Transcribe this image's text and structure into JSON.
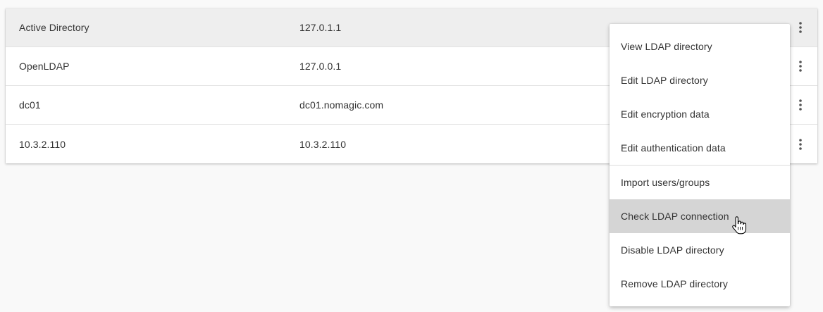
{
  "directories": [
    {
      "name": "Active Directory",
      "host": "127.0.1.1"
    },
    {
      "name": "OpenLDAP",
      "host": "127.0.0.1"
    },
    {
      "name": "dc01",
      "host": "dc01.nomagic.com"
    },
    {
      "name": "10.3.2.110",
      "host": "10.3.2.110"
    }
  ],
  "context_menu": {
    "items": [
      {
        "label": "View LDAP directory"
      },
      {
        "label": "Edit LDAP directory"
      },
      {
        "label": "Edit encryption data"
      },
      {
        "label": "Edit authentication data"
      },
      {
        "label": "Import users/groups"
      },
      {
        "label": "Check LDAP connection"
      },
      {
        "label": "Disable LDAP directory"
      },
      {
        "label": "Remove LDAP directory"
      }
    ],
    "hovered_item": "Check LDAP connection"
  },
  "icons": {
    "row_menu": "more-vert-icon",
    "cursor": "hand-pointer-icon"
  },
  "colors": {
    "selected_row": "#eeeeee",
    "hovered_item": "#d5d5d5",
    "text": "#333333"
  }
}
